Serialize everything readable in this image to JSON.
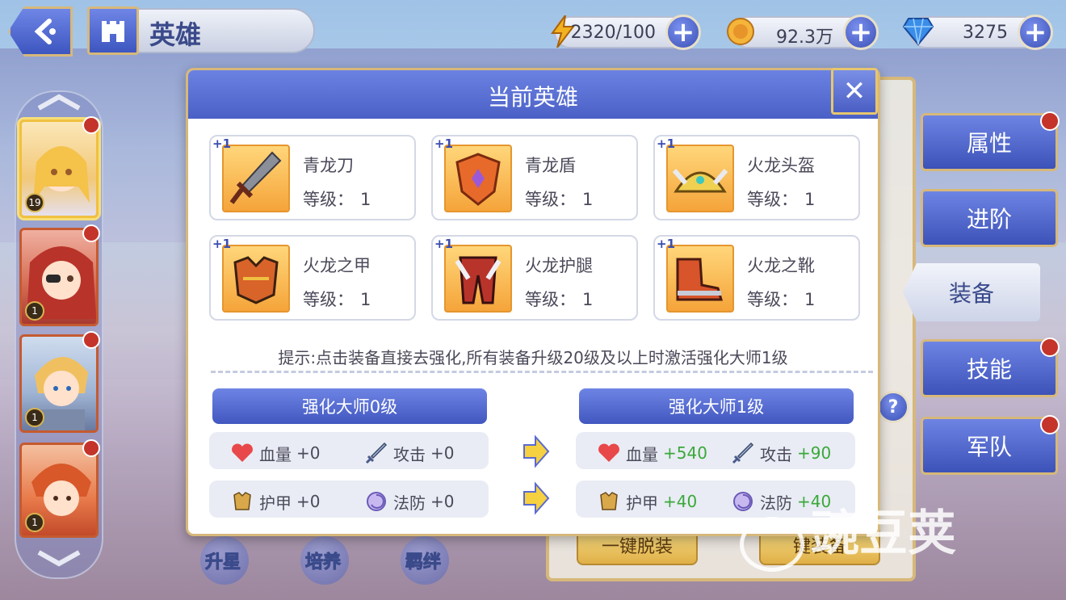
{
  "header": {
    "title": "英雄",
    "resources": [
      {
        "icon": "lightning-icon",
        "value": "2320/100"
      },
      {
        "icon": "coin-icon",
        "value": "92.3万"
      },
      {
        "icon": "gem-icon",
        "value": "3275"
      }
    ]
  },
  "heroes": [
    {
      "level": "19",
      "selected": true
    },
    {
      "level": "1"
    },
    {
      "level": "1"
    },
    {
      "level": "1"
    }
  ],
  "tabs": [
    "属性",
    "进阶",
    "装备",
    "技能",
    "军队"
  ],
  "background": {
    "buttons": [
      "一键脱装",
      "键装备"
    ],
    "bottom_labels": [
      "升星",
      "培养",
      "羁绊"
    ]
  },
  "modal": {
    "title": "当前英雄",
    "close": "✕",
    "equipment": [
      {
        "plus": "+1",
        "name": "青龙刀",
        "level_label": "等级：",
        "level": "1",
        "icon": "sword-icon"
      },
      {
        "plus": "+1",
        "name": "青龙盾",
        "level_label": "等级：",
        "level": "1",
        "icon": "shield-icon"
      },
      {
        "plus": "+1",
        "name": "火龙头盔",
        "level_label": "等级：",
        "level": "1",
        "icon": "helmet-icon"
      },
      {
        "plus": "+1",
        "name": "火龙之甲",
        "level_label": "等级：",
        "level": "1",
        "icon": "armor-icon"
      },
      {
        "plus": "+1",
        "name": "火龙护腿",
        "level_label": "等级：",
        "level": "1",
        "icon": "leggings-icon"
      },
      {
        "plus": "+1",
        "name": "火龙之靴",
        "level_label": "等级：",
        "level": "1",
        "icon": "boots-icon"
      }
    ],
    "hint": "提示:点击装备直接去强化,所有装备升级20级及以上时激活强化大师1级",
    "current": {
      "title": "强化大师0级",
      "hp_label": "血量",
      "hp": "+0",
      "atk_label": "攻击",
      "atk": "+0",
      "armor_label": "护甲",
      "armor": "+0",
      "mres_label": "法防",
      "mres": "+0"
    },
    "next": {
      "title": "强化大师1级",
      "hp_label": "血量",
      "hp": "+540",
      "atk_label": "攻击",
      "atk": "+90",
      "armor_label": "护甲",
      "armor": "+40",
      "mres_label": "法防",
      "mres": "+40"
    }
  },
  "watermark": "豌豆荚"
}
